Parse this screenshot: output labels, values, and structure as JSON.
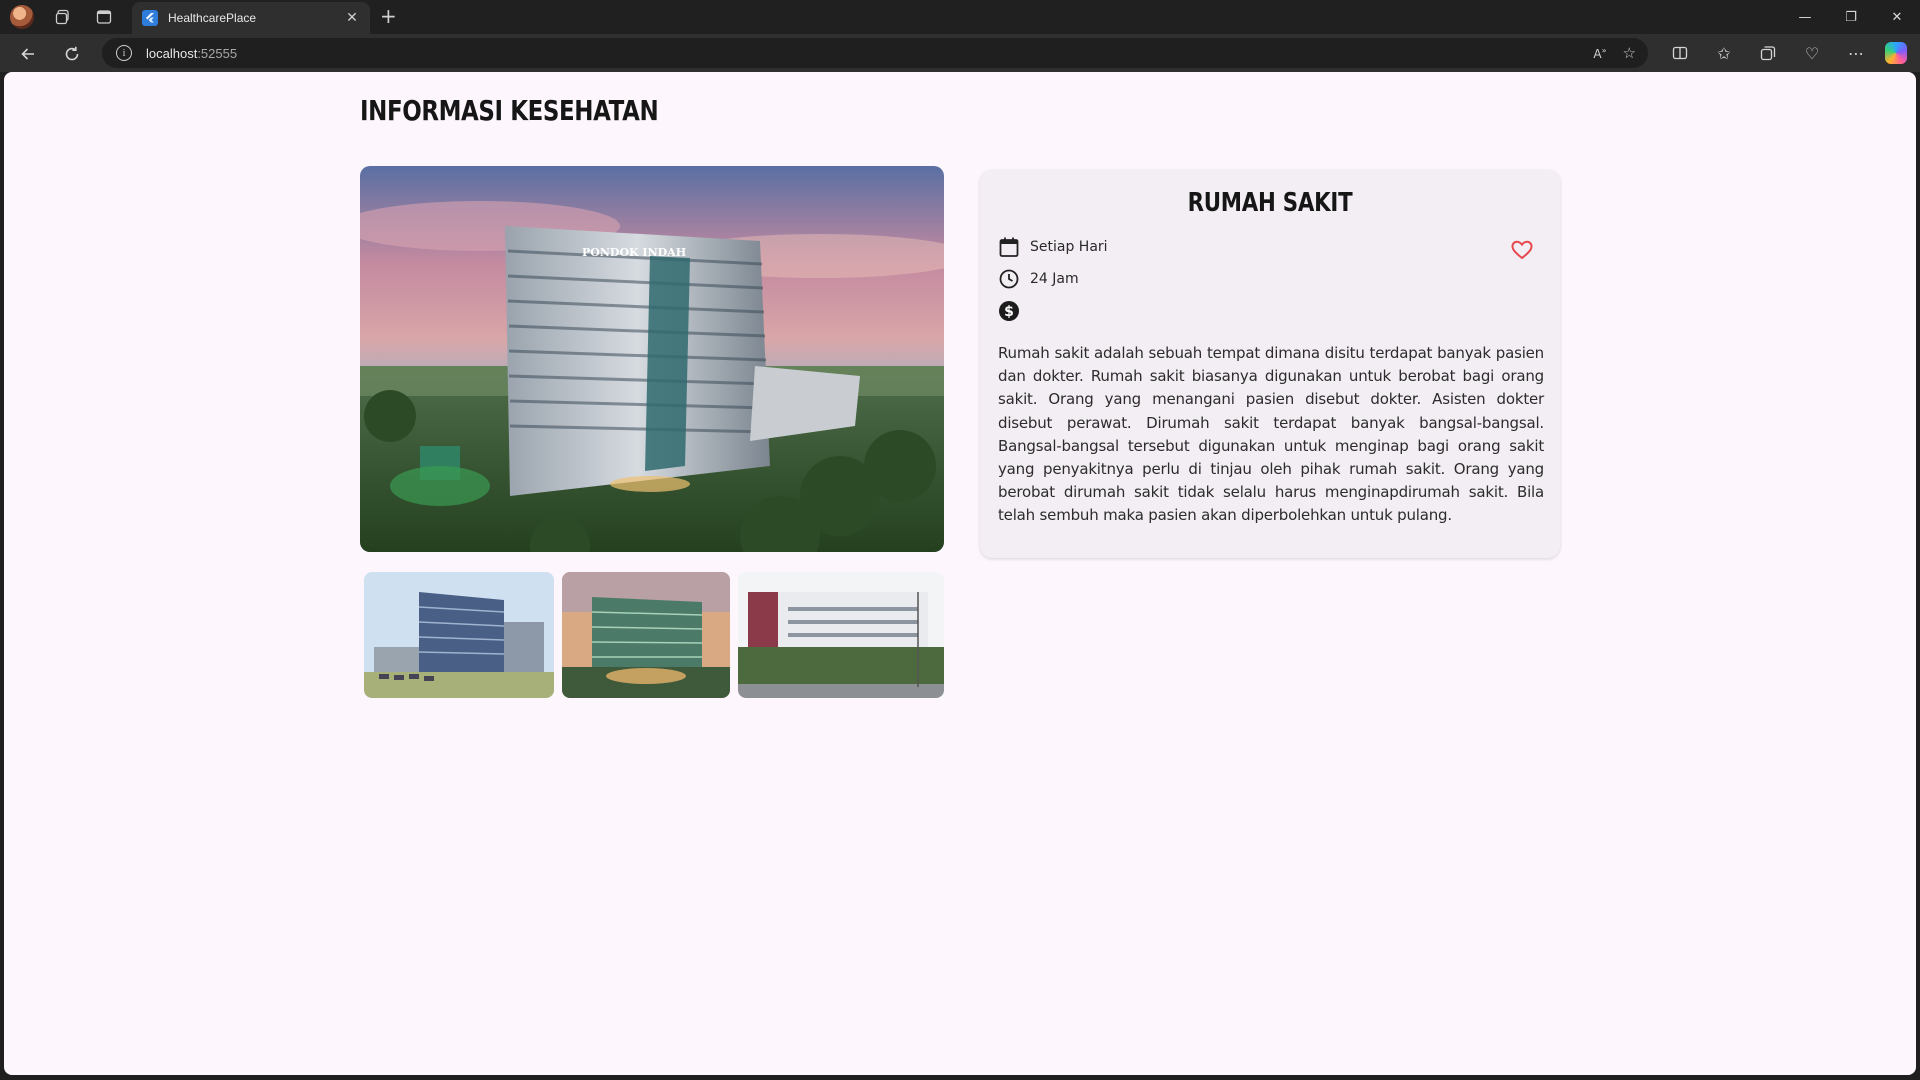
{
  "browser": {
    "tab_title": "HealthcarePlace",
    "url_host": "localhost",
    "url_port": ":52555"
  },
  "page": {
    "title": "INFORMASI KESEHATAN"
  },
  "detail": {
    "title": "RUMAH SAKIT",
    "schedule_days": "Setiap Hari",
    "schedule_hours": "24 Jam",
    "price": "",
    "description": "Rumah sakit adalah sebuah tempat dimana disitu terdapat banyak pasien dan dokter. Rumah sakit biasanya digunakan untuk berobat bagi orang sakit. Orang yang menangani pasien disebut dokter. Asisten dokter disebut perawat. Dirumah sakit terdapat banyak bangsal-bangsal. Bangsal-bangsal tersebut digunakan untuk menginap bagi orang sakit yang penyakitnya perlu di tinjau oleh pihak rumah sakit. Orang yang berobat dirumah sakit tidak selalu harus menginapdirumah sakit. Bila telah sembuh maka pasien akan diperbolehkan untuk pulang."
  },
  "icons": {
    "calendar": "calendar-icon",
    "clock": "clock-icon",
    "price": "dollar-icon",
    "favorite": "heart-icon"
  },
  "colors": {
    "page_bg": "#fdf7fd",
    "card_bg": "#f3eef3",
    "heart": "#e5484d",
    "browser_chrome": "#202020"
  }
}
